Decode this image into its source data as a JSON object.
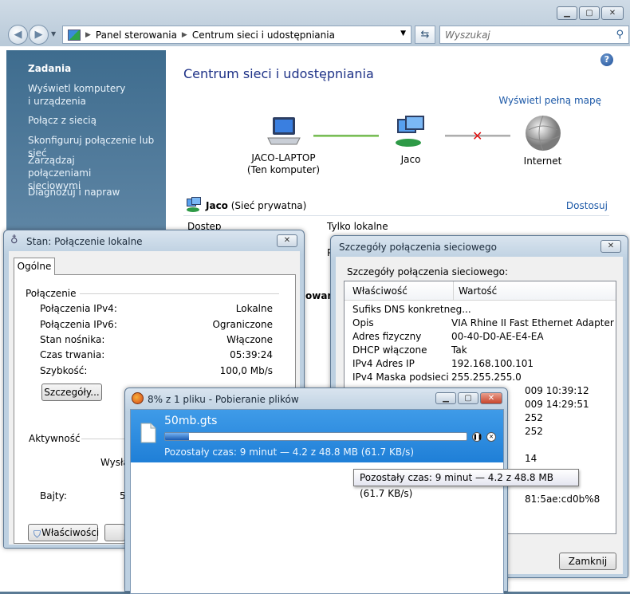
{
  "explorer": {
    "breadcrumb": [
      "Panel sterowania",
      "Centrum sieci i udostępniania"
    ],
    "search_placeholder": "Wyszukaj",
    "sidebar": {
      "title": "Zadania",
      "items": [
        "Wyświetl komputery i urządzenia",
        "Połącz z siecią",
        "Skonfiguruj połączenie lub sieć",
        "Zarządzaj połączeniami sieciowymi",
        "Diagnozuj i napraw"
      ]
    },
    "content": {
      "title": "Centrum sieci i udostępniania",
      "full_map_link": "Wyświetl pełną mapę",
      "map": {
        "computer_label": "JACO-LAPTOP",
        "computer_sub": "(Ten komputer)",
        "network_label": "Jaco",
        "internet_label": "Internet"
      },
      "network_name": "Jaco",
      "network_type": "(Sieć prywatna)",
      "customize_link": "Dostosuj",
      "access_label": "Dostęp",
      "access_value": "Tylko lokalne",
      "partial_p": "P",
      "partial_owani": "owani"
    }
  },
  "stan": {
    "title": "Stan: Połączenie lokalne",
    "tab": "Ogólne",
    "group_connection": "Połączenie",
    "rows": [
      {
        "label": "Połączenia IPv4:",
        "value": "Lokalne"
      },
      {
        "label": "Połączenia IPv6:",
        "value": "Ograniczone"
      },
      {
        "label": "Stan nośnika:",
        "value": "Włączone"
      },
      {
        "label": "Czas trwania:",
        "value": "05:39:24"
      },
      {
        "label": "Szybkość:",
        "value": "100,0 Mb/s"
      }
    ],
    "details_button": "Szczegóły...",
    "group_activity": "Aktywność",
    "sent_partial": "Wysła",
    "bytes_label": "Bajty:",
    "bytes_partial": "5",
    "properties_button": "Właściwości"
  },
  "details": {
    "title": "Szczegóły połączenia sieciowego",
    "heading": "Szczegóły połączenia sieciowego:",
    "col_property": "Właściwość",
    "col_value": "Wartość",
    "rows": [
      {
        "p": "Sufiks DNS konkretneg...",
        "v": ""
      },
      {
        "p": "Opis",
        "v": "VIA Rhine II Fast Ethernet Adapter"
      },
      {
        "p": "Adres fizyczny",
        "v": "00-40-D0-AE-E4-EA"
      },
      {
        "p": "DHCP włączone",
        "v": "Tak"
      },
      {
        "p": "IPv4 Adres IP",
        "v": "192.168.100.101"
      },
      {
        "p": "IPv4 Maska podsieci",
        "v": "255.255.255.0"
      },
      {
        "p": "",
        "v": "009 10:39:12"
      },
      {
        "p": "",
        "v": "009 14:29:51"
      },
      {
        "p": "",
        "v": "252"
      },
      {
        "p": "",
        "v": "252"
      },
      {
        "p": "",
        "v": ""
      },
      {
        "p": "",
        "v": "14"
      },
      {
        "p": "",
        "v": ""
      },
      {
        "p": "",
        "v": ""
      },
      {
        "p": "",
        "v": "81:5ae:cd0b%8"
      }
    ],
    "close_button": "Zamknij"
  },
  "download": {
    "title": "8% z 1 pliku - Pobieranie plików",
    "file_name": "50mb.gts",
    "progress_percent": 8,
    "status": "Pozostały czas: 9 minut — 4.2 z 48.8 MB (61.7 KB/s)",
    "tooltip": "Pozostały czas: 9 minut — 4.2 z 48.8 MB (61.7 KB/s)"
  }
}
